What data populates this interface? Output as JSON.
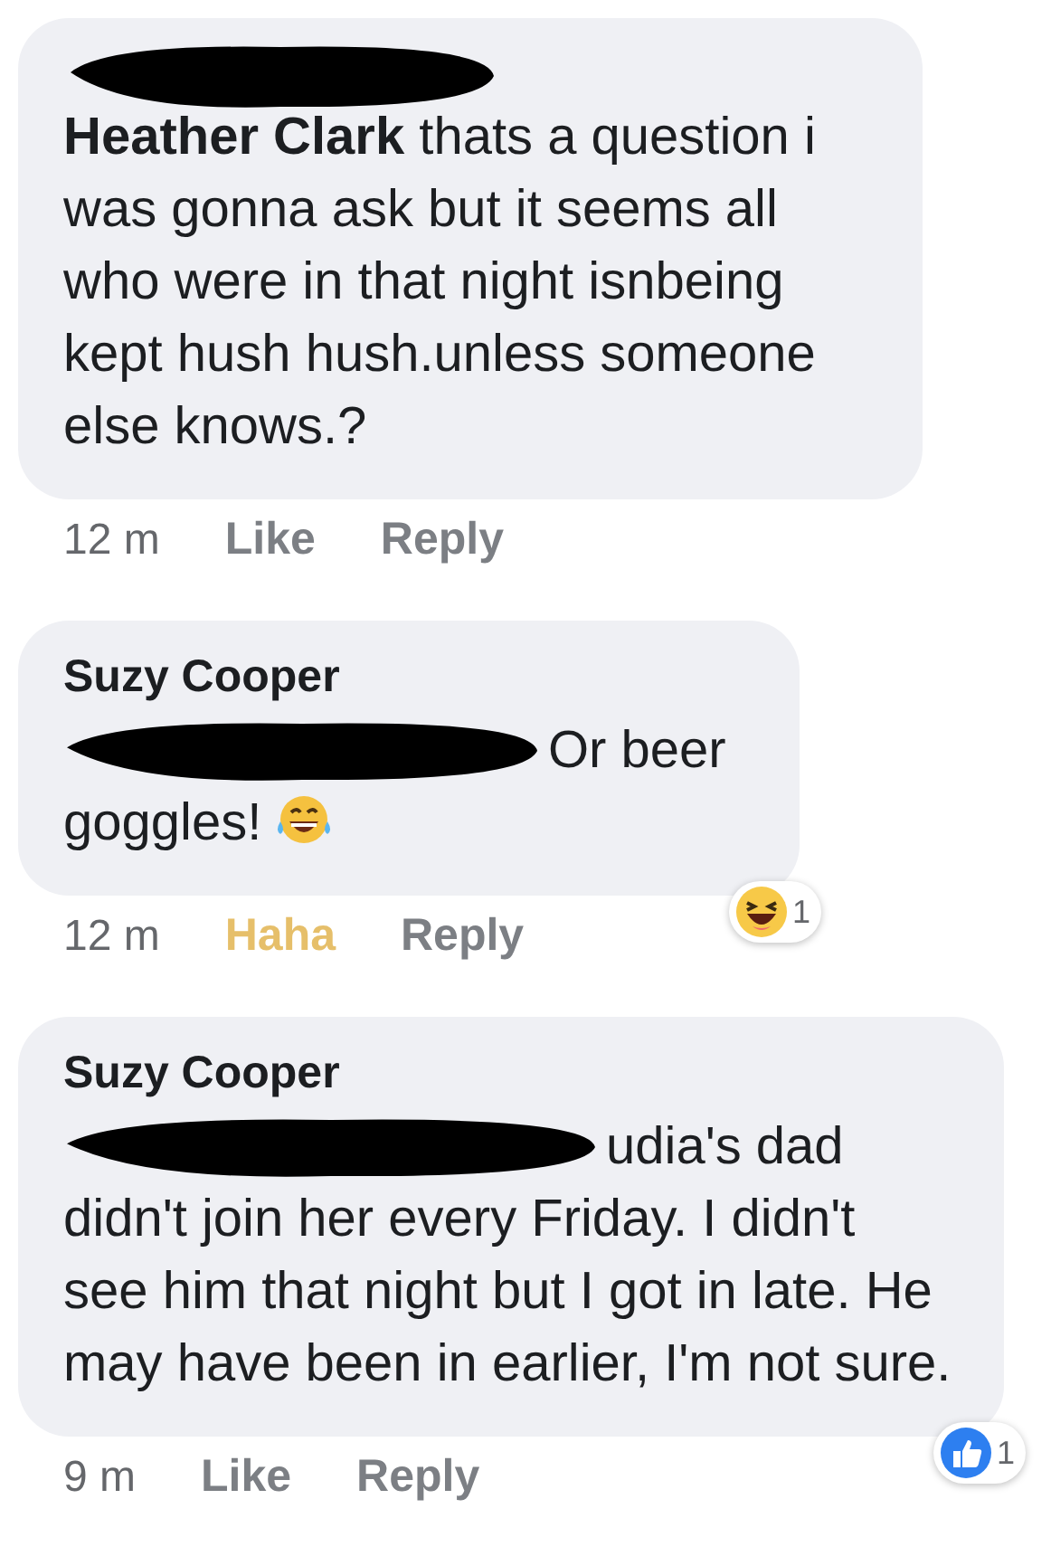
{
  "comments": [
    {
      "redacted_header": true,
      "redacted_lead": false,
      "body": "**Heather Clark** thats a question i was gonna ask but it seems all who were in that night isnbeing kept hush hush.unless someone else knows.?",
      "emoji": false,
      "time": "12 m",
      "actions": [
        {
          "label": "Like",
          "selected": false
        },
        {
          "label": "Reply",
          "selected": false
        }
      ]
    },
    {
      "author": "Suzy Cooper",
      "redacted_header": false,
      "redacted_lead": true,
      "body": "Or beer goggles!",
      "emoji": true,
      "time": "12 m",
      "actions": [
        {
          "label": "Haha",
          "selected": true
        },
        {
          "label": "Reply",
          "selected": false
        }
      ],
      "reaction": {
        "kind": "haha",
        "count": "1"
      }
    },
    {
      "author": "Suzy Cooper",
      "redacted_header": false,
      "redacted_lead": true,
      "body": "udia's dad didn't join her every Friday. I didn't see him that night but I got in late. He may have been in earlier, I'm not sure.",
      "emoji": false,
      "time": "9 m",
      "actions": [
        {
          "label": "Like",
          "selected": false
        },
        {
          "label": "Reply",
          "selected": false
        }
      ],
      "reaction": {
        "kind": "like",
        "count": "1"
      }
    }
  ]
}
